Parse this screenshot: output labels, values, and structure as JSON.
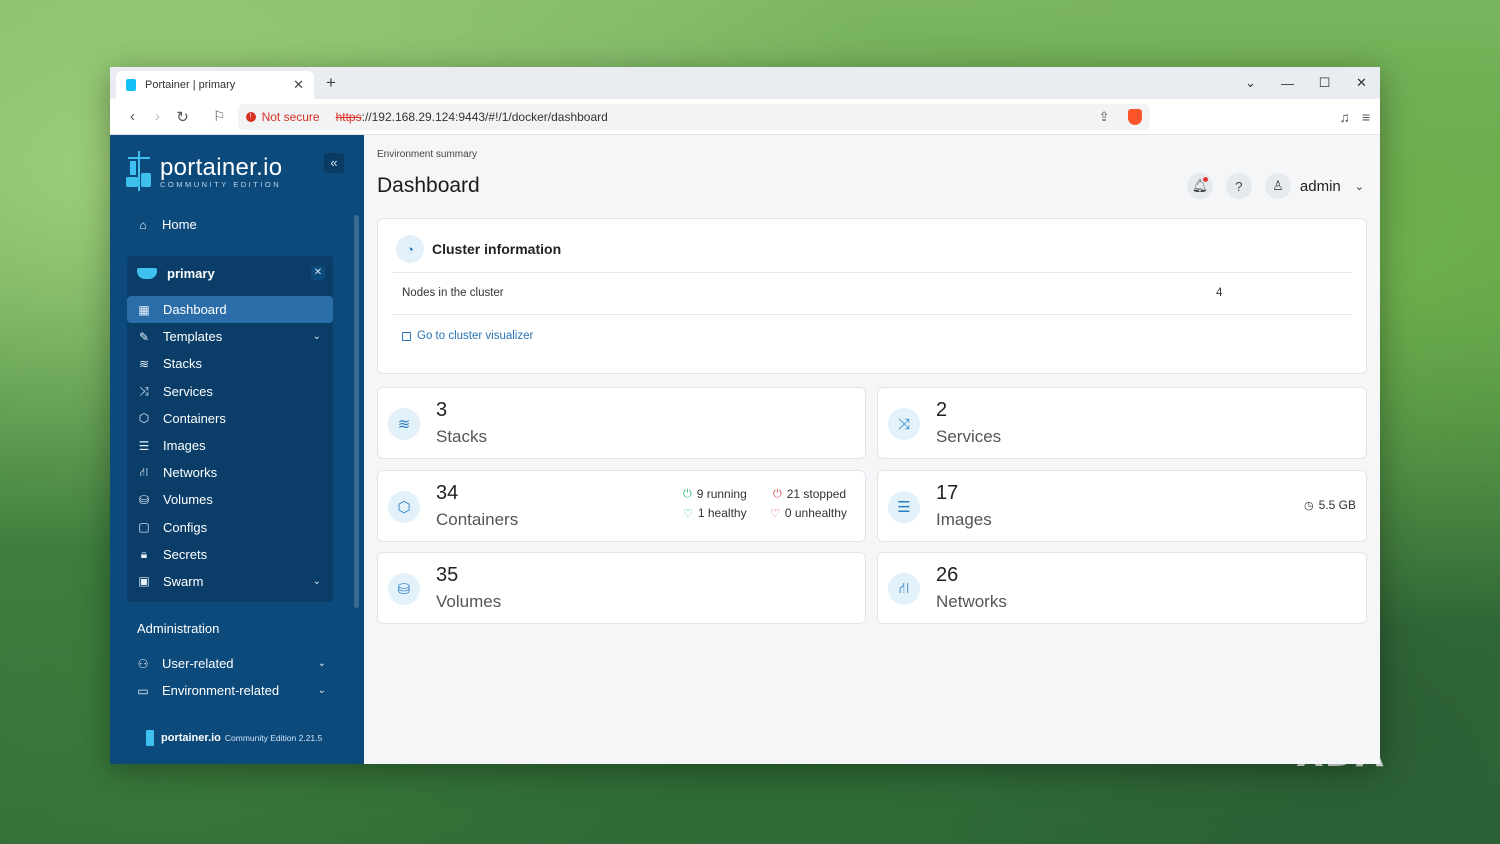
{
  "browser": {
    "tab_title": "Portainer | primary",
    "new_tab": "+",
    "security_label": "Not secure",
    "url_scheme": "https",
    "url_rest": "://192.168.29.124:9443/#!/1/docker/dashboard"
  },
  "sidebar": {
    "logo_name": "portainer.io",
    "logo_edition": "COMMUNITY EDITION",
    "home_label": "Home",
    "environment": "primary",
    "items": [
      {
        "label": "Dashboard",
        "icon": "dashboard-icon",
        "active": true,
        "expandable": false
      },
      {
        "label": "Templates",
        "icon": "edit-icon",
        "active": false,
        "expandable": true
      },
      {
        "label": "Stacks",
        "icon": "layers-icon",
        "active": false,
        "expandable": false
      },
      {
        "label": "Services",
        "icon": "shuffle-icon",
        "active": false,
        "expandable": false
      },
      {
        "label": "Containers",
        "icon": "box-icon",
        "active": false,
        "expandable": false
      },
      {
        "label": "Images",
        "icon": "list-icon",
        "active": false,
        "expandable": false
      },
      {
        "label": "Networks",
        "icon": "network-icon",
        "active": false,
        "expandable": false
      },
      {
        "label": "Volumes",
        "icon": "database-icon",
        "active": false,
        "expandable": false
      },
      {
        "label": "Configs",
        "icon": "clipboard-icon",
        "active": false,
        "expandable": false
      },
      {
        "label": "Secrets",
        "icon": "lock-icon",
        "active": false,
        "expandable": false
      },
      {
        "label": "Swarm",
        "icon": "swarm-icon",
        "active": false,
        "expandable": true
      }
    ],
    "administration_label": "Administration",
    "admin_items": [
      {
        "label": "User-related"
      },
      {
        "label": "Environment-related"
      }
    ],
    "footer_name": "portainer.io",
    "footer_edition": "Community Edition 2.21.5"
  },
  "header": {
    "breadcrumb": "Environment summary",
    "title": "Dashboard",
    "user": "admin"
  },
  "cluster": {
    "title": "Cluster information",
    "nodes_label": "Nodes in the cluster",
    "nodes_value": "4",
    "link_label": "Go to cluster visualizer"
  },
  "stats": {
    "stacks": {
      "count": "3",
      "label": "Stacks"
    },
    "services": {
      "count": "2",
      "label": "Services"
    },
    "containers": {
      "count": "34",
      "label": "Containers",
      "running": "9 running",
      "stopped": "21 stopped",
      "healthy": "1 healthy",
      "unhealthy": "0 unhealthy"
    },
    "images": {
      "count": "17",
      "label": "Images",
      "size": "5.5 GB"
    },
    "volumes": {
      "count": "35",
      "label": "Volumes"
    },
    "networks": {
      "count": "26",
      "label": "Networks"
    }
  },
  "watermark": "XDA",
  "colors": {
    "sidebar": "#0d4a7c",
    "accent": "#2a74b5",
    "running": "#2bb673",
    "stopped": "#d9534f"
  }
}
